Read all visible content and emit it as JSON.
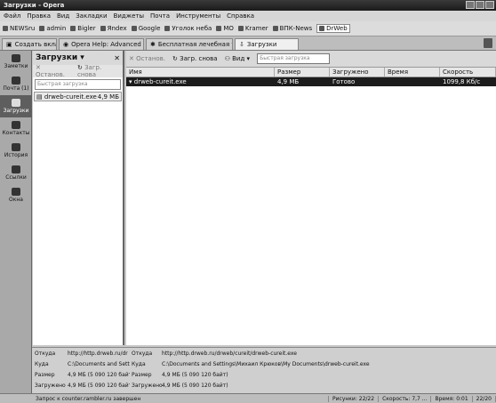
{
  "window": {
    "title": "Загрузки - Opera"
  },
  "menu": [
    "Файл",
    "Правка",
    "Вид",
    "Закладки",
    "Виджеты",
    "Почта",
    "Инструменты",
    "Справка"
  ],
  "bookmarks": [
    "NEWSru",
    "admin",
    "Bigler",
    "Яndex",
    "Google",
    "Уголок неба",
    "MO",
    "Kramer",
    "ВПК-News",
    "DrWeb"
  ],
  "tabs": {
    "new_tab": "Создать вкладку",
    "items": [
      "Opera Help: Advanced Pre...",
      "Бесплатная лечебная ут...",
      "Загрузки"
    ]
  },
  "sidebar": {
    "items": [
      "Заметки",
      "Почта (1)",
      "Загрузки",
      "Контакты",
      "История",
      "Ссылки",
      "Окна"
    ]
  },
  "panel": {
    "title": "Загрузки",
    "stop": "Останов.",
    "retry": "Загр. снова",
    "search_placeholder": "Быстрая загрузка",
    "file_name": "drweb-cureit.exe",
    "file_size": "4,9 МБ"
  },
  "main": {
    "stop": "Останов.",
    "retry": "Загр. снова",
    "view": "Вид",
    "search_placeholder": "Быстрая загрузка",
    "columns": [
      "Имя",
      "Размер",
      "Загружено",
      "Время",
      "Скорость"
    ],
    "rows": [
      [
        "drweb-cureit.exe",
        "4,9 МБ",
        "Готово",
        "",
        "1099,8 Кб/с"
      ]
    ]
  },
  "details": {
    "source_label": "Откуда",
    "source_short": "http://http.drweb.ru/dr",
    "source_full": "http://http.drweb.ru/drweb/cureit/drweb-cureit.exe",
    "dest_label": "Куда",
    "dest_short": "C:\\Documents and Settin",
    "dest_full": "C:\\Documents and Settings\\Михаил Крюков\\My Documents\\drweb-cureit.exe",
    "size_label": "Размер",
    "size_value": "4,9 МБ (5 090 120 байт)",
    "loaded_label": "Загружено",
    "loaded_value": "4,9 МБ (5 090 120 байт)"
  },
  "status": {
    "message": "Запрос к counter.rambler.ru завершен",
    "images": "Рисунки:",
    "images_count": "22/22",
    "speed": "Скорость:",
    "speed_value": "7,7 ...",
    "time": "Время:",
    "time_value": "0:01",
    "progress": "22/20"
  }
}
